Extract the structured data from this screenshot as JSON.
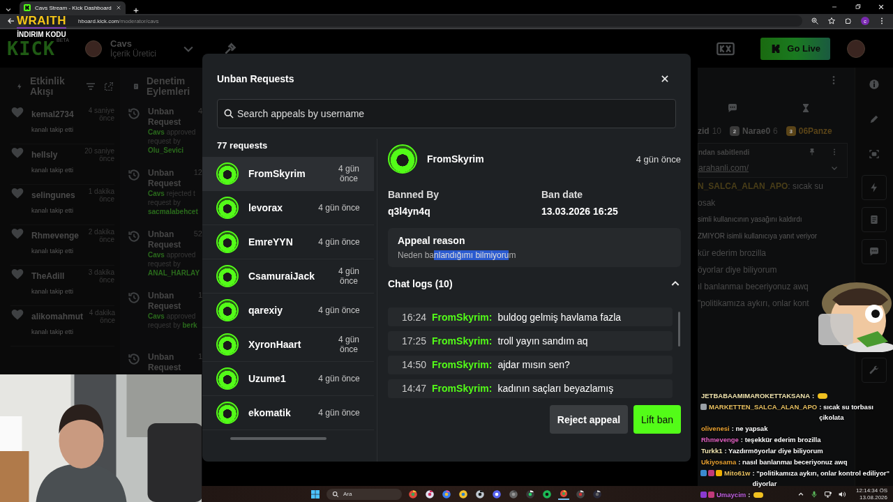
{
  "browser": {
    "tab_title": "Cavs Stream - Kick Dashboard",
    "selected": true,
    "url_host": "hboard.kick.com",
    "url_path": "/moderator/cavs",
    "profile": "c"
  },
  "sponsor_overlay": {
    "title": "WRAITH",
    "subtitle": "İNDIRIM KODU"
  },
  "header": {
    "logo": "KICK",
    "logo_badge": "BETA",
    "channel": "Cavs",
    "role": "İçerik Üretici",
    "go_live": "Go Live"
  },
  "activity": {
    "title": "Etkinlik Akışı",
    "items": [
      {
        "user": "kemal2734",
        "time": "4 saniye önce",
        "action": "kanalı takip etti"
      },
      {
        "user": "hellsly",
        "time": "20 saniye önce",
        "action": "kanalı takip etti"
      },
      {
        "user": "selingunes",
        "time": "1 dakika önce",
        "action": "kanalı takip etti"
      },
      {
        "user": "Rhmevenge",
        "time": "2 dakika önce",
        "action": "kanalı takip etti"
      },
      {
        "user": "TheAdill",
        "time": "3 dakika önce",
        "action": "kanalı takip etti"
      },
      {
        "user": "alikomahmut",
        "time": "4 dakika önce",
        "action": "kanalı takip etti"
      }
    ]
  },
  "moderation": {
    "title": "Denetim Eylemleri",
    "items": [
      {
        "title": "Unban Request",
        "time": "4",
        "actor": "Cavs",
        "verb": "approved",
        "text": "request by",
        "target": "Olu_Sevici"
      },
      {
        "title": "Unban Request",
        "time": "12",
        "actor": "Cavs",
        "verb": "rejected t",
        "text": "request by",
        "target": "sacmalabehcet"
      },
      {
        "title": "Unban Request",
        "time": "52",
        "actor": "Cavs",
        "verb": "approved",
        "text": "request by",
        "target": "ANAL_HARLAY"
      },
      {
        "title": "Unban Request",
        "time": "1",
        "actor": "Cavs",
        "verb": "approved",
        "text": "request by",
        "target": "berk"
      },
      {
        "title": "Unban Request",
        "time": "1"
      }
    ]
  },
  "chat_panel": {
    "leaders": [
      {
        "name": "zid",
        "score": "10"
      },
      {
        "rank": "2",
        "name": "Narae0",
        "score": "6"
      },
      {
        "rank": "3",
        "name": "06Panze"
      }
    ],
    "pinned": {
      "label": "ndan sabitlendi",
      "link": "arahanli.com/"
    },
    "lines": [
      {
        "kind": "message",
        "user": "N_SALCA_ALAN_APO",
        "text": ": sıcak su"
      },
      {
        "kind": "message",
        "text": "osak"
      },
      {
        "kind": "system",
        "text": "simli kullanıcının yasağını kaldırdı"
      },
      {
        "kind": "system",
        "text": "ZMIYOR isimli kullanıcıya yanıt veriyor"
      },
      {
        "kind": "message",
        "text": "kür ederim brozilla"
      },
      {
        "kind": "message",
        "text": "öyorlar diye biliyorum"
      },
      {
        "kind": "message",
        "text": "ıl banlanmaı beceriyonuz awq"
      },
      {
        "kind": "message",
        "text": "\"politikamıza aykırı, onlar kont"
      }
    ]
  },
  "modal": {
    "title": "Unban Requests",
    "search": {
      "placeholder": "Search appeals by username"
    },
    "count": "77 requests",
    "requests": [
      {
        "user": "FromSkyrim",
        "time": "4 gün önce",
        "selected": true
      },
      {
        "user": "levorax",
        "time": "4 gün önce",
        "selected": false
      },
      {
        "user": "EmreYYN",
        "time": "4 gün önce",
        "selected": false
      },
      {
        "user": "CsamuraiJack",
        "time": "4 gün önce",
        "selected": false
      },
      {
        "user": "qarexiy",
        "time": "4 gün önce",
        "selected": false
      },
      {
        "user": "XyronHaart",
        "time": "4 gün önce",
        "selected": false
      },
      {
        "user": "Uzume1",
        "time": "4 gün önce",
        "selected": false
      },
      {
        "user": "ekomatik",
        "time": "4 gün önce",
        "selected": false
      }
    ],
    "detail": {
      "user": "FromSkyrim",
      "time": "4 gün önce",
      "banned_by_label": "Banned By",
      "banned_by": "q3l4yn4q",
      "ban_date_label": "Ban date",
      "ban_date": "13.03.2026 16:25",
      "appeal_label": "Appeal reason",
      "appeal_before": "Neden ba",
      "appeal_selected": "nlandığımı bilmiyoru",
      "appeal_after": "m",
      "chat_logs_title": "Chat logs (10)",
      "chat_logs_expanded": true,
      "chat_logs": [
        {
          "time": "16:24",
          "user": "FromSkyrim:",
          "text": "buldog gelmiş havlama fazla"
        },
        {
          "time": "17:25",
          "user": "FromSkyrim:",
          "text": "troll yayın sandım aq"
        },
        {
          "time": "14:50",
          "user": "FromSkyrim:",
          "text": "ajdar mısın sen?"
        },
        {
          "time": "14:47",
          "user": "FromSkyrim:",
          "text": "kadının saçları beyazlamış"
        }
      ]
    },
    "buttons": [
      {
        "kind": "secondary",
        "label": "Reject appeal"
      },
      {
        "kind": "primary",
        "label": "Lift ban"
      }
    ]
  },
  "stream_chat": [
    {
      "user": "JETBABAAMIMAROKETTAKSANA",
      "color": "#f2e6b0",
      "text": ":",
      "emote": true
    },
    {
      "user": "MARKETTEN_SALCA_ALAN_APO",
      "color": "#e8c060",
      "text": ": sıcak su torbası çikolata",
      "badges": [
        {
          "color": "#9aa0a6"
        }
      ]
    },
    {
      "user": "olivenesi",
      "color": "#e8a030",
      "text": ": ne yapsak"
    },
    {
      "user": "Rhmevenge",
      "color": "#e060c0",
      "text": ": teşekkür ederim brozilla"
    },
    {
      "user": "Turkk1",
      "color": "#f2e6b0",
      "text": ": Yazdırmöyorlar diye biliyorum"
    },
    {
      "user": "Ukiyosama",
      "color": "#e8a030",
      "text": ": nasıl banlanmaı beceriyonuz awq"
    },
    {
      "user": "Mito61w",
      "color": "#e8c060",
      "text": ": \"politikamıza aykırı, onlar kontrol ediliyor\" diyorlar",
      "badges": [
        {
          "color": "#3a8ad0"
        },
        {
          "color": "#c03a7a"
        },
        {
          "color": "#f0b000"
        }
      ]
    },
    {
      "user": "Umaycim",
      "color": "#c060e0",
      "text": ":",
      "emote": true,
      "badges": [
        {
          "color": "#8a3ad0"
        },
        {
          "color": "#c03a7a"
        }
      ]
    }
  ],
  "taskbar": {
    "search": "Ara",
    "apps": [
      {
        "kind": "chrome",
        "selected": false
      },
      {
        "kind": "snip",
        "selected": false
      },
      {
        "kind": "copilot",
        "selected": false
      },
      {
        "kind": "folder",
        "selected": false
      },
      {
        "kind": "ccleaner",
        "selected": false
      },
      {
        "kind": "discord",
        "selected": false
      },
      {
        "kind": "game",
        "selected": false
      },
      {
        "kind": "whatsapp",
        "selected": false
      },
      {
        "kind": "spotify",
        "selected": false
      },
      {
        "kind": "chrome",
        "selected": true
      },
      {
        "kind": "obs",
        "selected": false
      },
      {
        "kind": "media",
        "selected": false
      }
    ],
    "time": "12:14:34 ÖS",
    "date": "13.08.2026"
  }
}
